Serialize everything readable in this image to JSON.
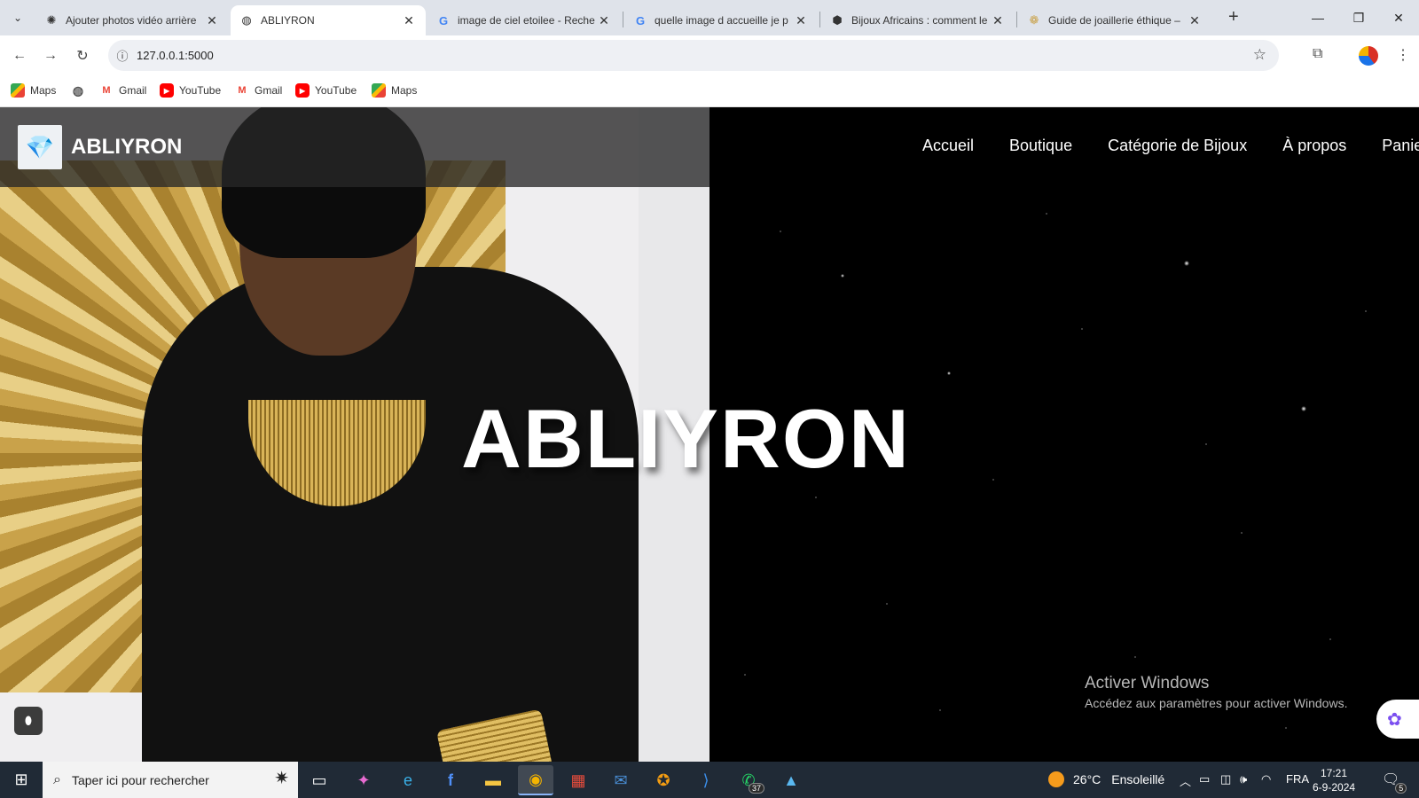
{
  "browser": {
    "tabs": [
      {
        "title": "Ajouter photos vidéo arrière",
        "icon": "openai-icon"
      },
      {
        "title": "ABLIYRON",
        "icon": "globe-icon"
      },
      {
        "title": "image de ciel etoilee - Reche",
        "icon": "google-icon"
      },
      {
        "title": "quelle image d accueille je p",
        "icon": "google-icon"
      },
      {
        "title": "Bijoux Africains : comment le",
        "icon": "africa-icon"
      },
      {
        "title": "Guide de joaillerie éthique –",
        "icon": "site-icon"
      }
    ],
    "active_tab_index": 1,
    "url": "127.0.0.1:5000",
    "bookmarks": [
      {
        "label": "Maps",
        "icon": "maps-icon"
      },
      {
        "label": "",
        "icon": "globe-icon"
      },
      {
        "label": "Gmail",
        "icon": "gmail-icon"
      },
      {
        "label": "YouTube",
        "icon": "youtube-icon"
      },
      {
        "label": "Gmail",
        "icon": "gmail-icon"
      },
      {
        "label": "YouTube",
        "icon": "youtube-icon"
      },
      {
        "label": "Maps",
        "icon": "maps-icon"
      }
    ]
  },
  "site": {
    "brand": "ABLIYRON",
    "nav": [
      "Accueil",
      "Boutique",
      "Catégorie de Bijoux",
      "À propos",
      "Panier"
    ],
    "hero_title": "ABLIYRON"
  },
  "windows": {
    "activation_title": "Activer Windows",
    "activation_text": "Accédez aux paramètres pour activer Windows.",
    "search_placeholder": "Taper ici pour rechercher",
    "whatsapp_badge": "37",
    "weather_temp": "26°C",
    "weather_text": "Ensoleillé",
    "language": "FRA",
    "time": "17:21",
    "date": "6-9-2024",
    "notification_count": "5"
  },
  "colors": {
    "tabstrip": "#dfe3ea",
    "taskbar": "#202a36",
    "gold": "#c9a24a"
  }
}
